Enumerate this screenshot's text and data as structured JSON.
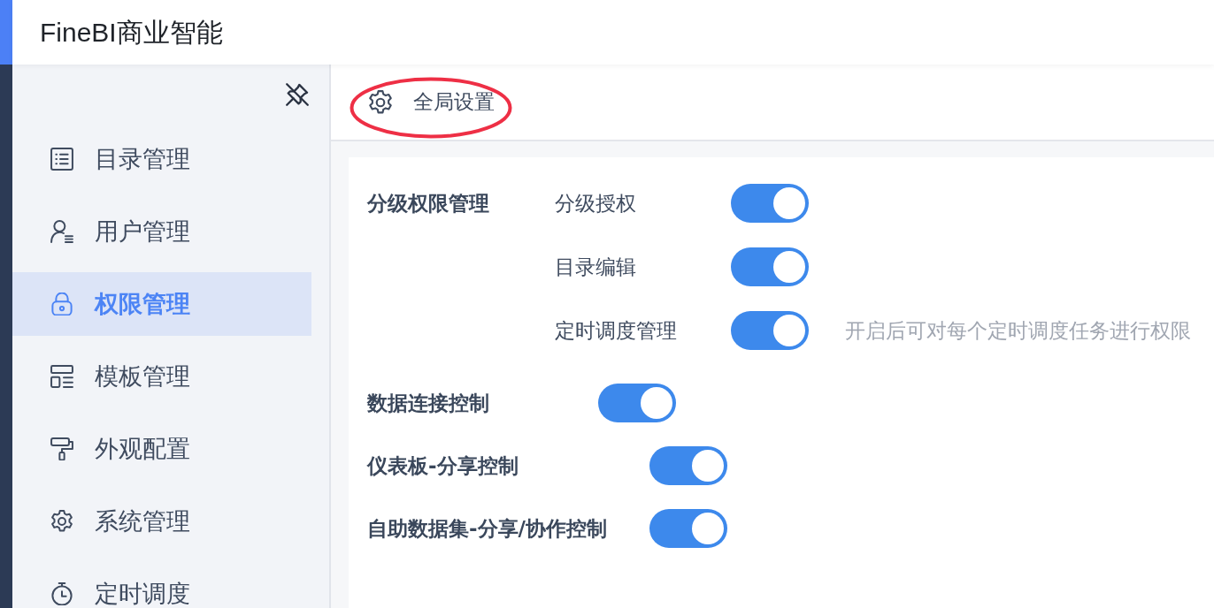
{
  "header": {
    "title": "FineBI商业智能"
  },
  "sidebar": {
    "items": [
      {
        "label": "目录管理",
        "selected": false
      },
      {
        "label": "用户管理",
        "selected": false
      },
      {
        "label": "权限管理",
        "selected": true
      },
      {
        "label": "模板管理",
        "selected": false
      },
      {
        "label": "外观配置",
        "selected": false
      },
      {
        "label": "系统管理",
        "selected": false
      },
      {
        "label": "定时调度",
        "selected": false
      }
    ]
  },
  "page": {
    "title": "全局设置"
  },
  "settings": [
    {
      "kind": "group",
      "label": "分级权限管理",
      "children": [
        {
          "label": "分级授权",
          "on": true
        },
        {
          "label": "目录编辑",
          "on": true
        },
        {
          "label": "定时调度管理",
          "on": true,
          "hint": "开启后可对每个定时调度任务进行权限"
        }
      ]
    },
    {
      "kind": "single",
      "label": "数据连接控制",
      "on": true
    },
    {
      "kind": "single",
      "label": "仪表板-分享控制",
      "on": true
    },
    {
      "kind": "single",
      "label": "自助数据集-分享/协作控制",
      "on": true
    }
  ]
}
